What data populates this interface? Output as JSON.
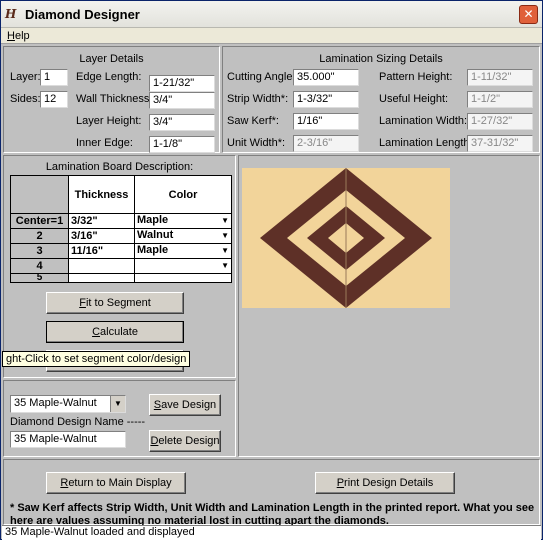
{
  "window": {
    "title": "Diamond Designer",
    "close_glyph": "✕",
    "icon_text": "H"
  },
  "menu": {
    "help": "Help"
  },
  "layer_details": {
    "heading": "Layer Details",
    "layer_label": "Layer:",
    "layer_value": "1",
    "sides_label": "Sides:",
    "sides_value": "12",
    "edge_length_label": "Edge Length:",
    "edge_length_value": "1-21/32\"",
    "wall_thickness_label": "Wall Thickness:",
    "wall_thickness_value": "3/4\"",
    "layer_height_label": "Layer Height:",
    "layer_height_value": "3/4\"",
    "inner_edge_label": "Inner Edge:",
    "inner_edge_value": "1-1/8\""
  },
  "lamination_sizing": {
    "heading": "Lamination Sizing Details",
    "cutting_angle_label": "Cutting Angle:",
    "cutting_angle_value": "35.000\"",
    "strip_width_label": "Strip Width*:",
    "strip_width_value": "1-3/32\"",
    "saw_kerf_label": "Saw Kerf*:",
    "saw_kerf_value": "1/16\"",
    "unit_width_label": "Unit Width*:",
    "unit_width_value": "2-3/16\"",
    "pattern_height_label": "Pattern Height:",
    "pattern_height_value": "1-11/32\"",
    "useful_height_label": "Useful Height:",
    "useful_height_value": "1-1/2\"",
    "lamination_width_label": "Lamination Width:",
    "lamination_width_value": "1-27/32\"",
    "lamination_length_label": "Lamination Length*:",
    "lamination_length_value": "37-31/32\""
  },
  "board": {
    "heading": "Lamination Board Description:",
    "col_thickness": "Thickness",
    "col_color": "Color",
    "rows": [
      {
        "label": "Center=1",
        "thickness": "3/32\"",
        "color": "Maple"
      },
      {
        "label": "2",
        "thickness": "3/16\"",
        "color": "Walnut"
      },
      {
        "label": "3",
        "thickness": "11/16\"",
        "color": "Maple"
      },
      {
        "label": "4",
        "thickness": "",
        "color": ""
      },
      {
        "label": "5",
        "thickness": "",
        "color": ""
      }
    ]
  },
  "buttons": {
    "fit": "Fit to Segment",
    "calculate": "Calculate",
    "save": "Save Design",
    "delete": "Delete Design",
    "return": "Return to Main Display",
    "print": "Print Design Details"
  },
  "tooltip": "ght-Click to set segment color/design",
  "design": {
    "combo_value": "35 Maple-Walnut",
    "name_label": "Diamond Design Name -----",
    "name_value": "35 Maple-Walnut"
  },
  "preview": {
    "background": "#f2d49a",
    "walnut": "#5e3027",
    "maple": "#f2d49a"
  },
  "note": "* Saw Kerf affects Strip Width, Unit Width and Lamination Length in the printed report. What you see here are values assuming no material lost in cutting apart the diamonds.",
  "status": "35 Maple-Walnut loaded and displayed"
}
